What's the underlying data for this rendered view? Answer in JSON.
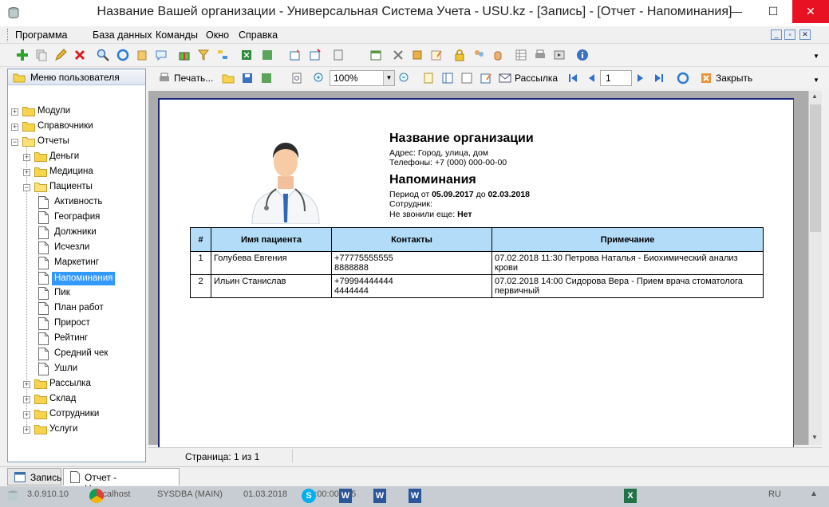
{
  "window": {
    "title": "Название Вашей организации - Универсальная Система Учета - USU.kz - [Запись] - [Отчет - Напоминания]",
    "min": "—",
    "max": "☐",
    "close": "✕"
  },
  "menu": {
    "items": [
      "Программа",
      "База данных",
      "Команды",
      "Окно",
      "Справка"
    ]
  },
  "sidebar": {
    "header": "Меню пользователя",
    "pin": "⊣",
    "tree": [
      "Модули",
      "Справочники",
      "Отчеты",
      "Деньги",
      "Медицина",
      "Пациенты",
      "Активность",
      "География",
      "Должники",
      "Исчезли",
      "Маркетинг",
      "Напоминания",
      "Пик",
      "План работ",
      "Прирост",
      "Рейтинг",
      "Средний чек",
      "Ушли",
      "Рассылка",
      "Склад",
      "Сотрудники",
      "Услуги"
    ]
  },
  "toolbar2": {
    "print": "Печать...",
    "zoom": "100%",
    "mail": "Рассылка",
    "page": "1",
    "close": "Закрыть"
  },
  "report": {
    "org_title": "Название организации",
    "address": "Адрес: Город, улица, дом",
    "phones": "Телефоны: +7 (000) 000-00-00",
    "title": "Напоминания",
    "period_prefix": "Период от ",
    "period_from": "05.09.2017",
    "period_mid": " до ",
    "period_to": "02.03.2018",
    "employee": "Сотрудник:",
    "not_called_prefix": "Не звонили еще: ",
    "not_called_value": "Нет",
    "columns": [
      "#",
      "Имя пациента",
      "Контакты",
      "Примечание"
    ],
    "rows": [
      {
        "n": "1",
        "name": "Голубева Евгения",
        "contact1": "+77775555555",
        "contact2": "8888888",
        "note1": "07.02.2018 11:30 Петрова Наталья - Биохимический анализ крови",
        "note2": ""
      },
      {
        "n": "2",
        "name": "Ильин Станислав",
        "contact1": "+79994444444",
        "contact2": "4444444",
        "note1": "07.02.2018 14:00 Сидорова Вера - Прием врача стоматолога",
        "note2": "первичный"
      }
    ]
  },
  "status": {
    "page": "Страница: 1 из 1"
  },
  "tabs": [
    "Запись",
    "Отчет - Напоминания"
  ],
  "taskbar": {
    "version": "3.0.910.10",
    "host": "localhost",
    "db": "SYSDBA (MAIN)",
    "date": "01.03.2018",
    "time": "00:00:00:135",
    "lang": "RU"
  },
  "colors": {
    "accent": "#3399ff",
    "table_header": "#b3dcf9",
    "close": "#e81123"
  }
}
